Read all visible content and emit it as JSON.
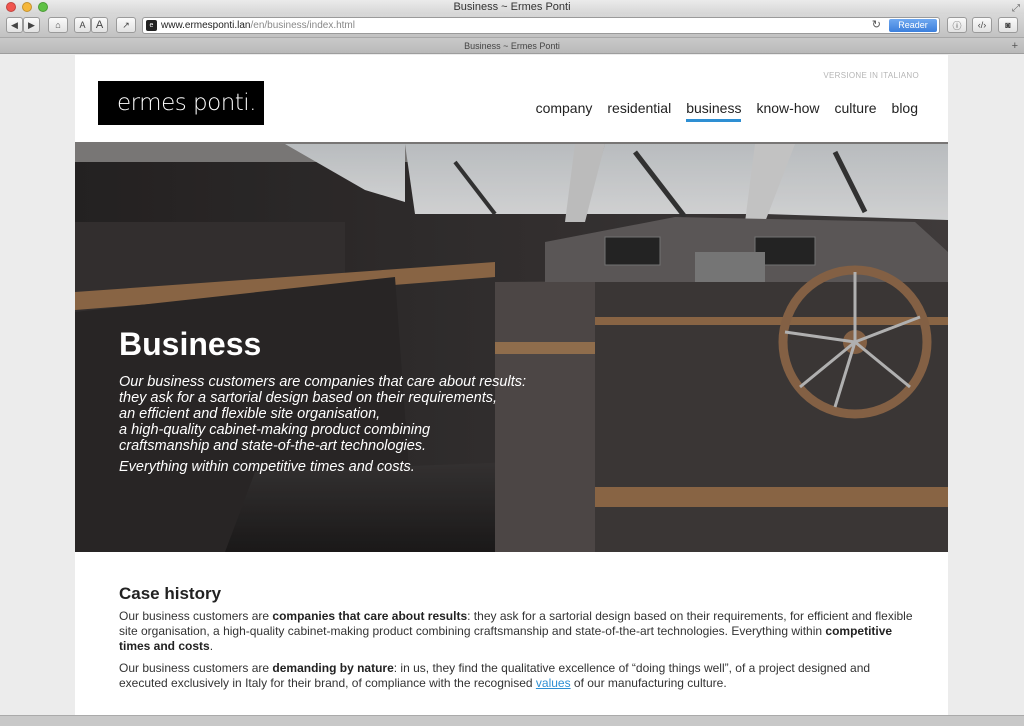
{
  "browser": {
    "window_title": "Business ~ Ermes Ponti",
    "tab_title": "Business ~ Ermes Ponti",
    "url_host": "www.ermesponti.lan",
    "url_path": "/en/business/index.html",
    "reader_label": "Reader",
    "font_small_label": "A",
    "font_large_label": "A"
  },
  "site": {
    "logo_text": "ermes ponti.",
    "lang_link": "VERSIONE IN ITALIANO",
    "nav": [
      {
        "label": "company"
      },
      {
        "label": "residential"
      },
      {
        "label": "business",
        "active": true
      },
      {
        "label": "know-how"
      },
      {
        "label": "culture"
      },
      {
        "label": "blog"
      }
    ],
    "accent_color": "#2e8fd3"
  },
  "hero": {
    "title": "Business",
    "lines": [
      "Our business customers are companies that care about results:",
      "they ask for a sartorial design based on their requirements,",
      "an efficient and flexible site organisation,",
      "a high-quality cabinet-making product combining",
      "craftsmanship and state-of-the-art technologies."
    ],
    "closing": "Everything within competitive times and costs."
  },
  "case_history": {
    "title": "Case history",
    "p1_a": "Our business customers are ",
    "p1_b": "companies that care about results",
    "p1_c": ": they ask for a sartorial design based on their requirements, for efficient and flexible site organisation, a high-quality cabinet-making product combining craftsmanship and state-of-the-art technologies. Everything within ",
    "p1_d": "competitive times and costs",
    "p1_e": ".",
    "p2_a": "Our business customers are ",
    "p2_b": "demanding by nature",
    "p2_c": ": in us, they find the qualitative excellence of “doing things well”, of a project designed and executed exclusively in Italy for their brand, of compliance with the recognised ",
    "p2_link": "values",
    "p2_d": " of our manufacturing culture."
  }
}
